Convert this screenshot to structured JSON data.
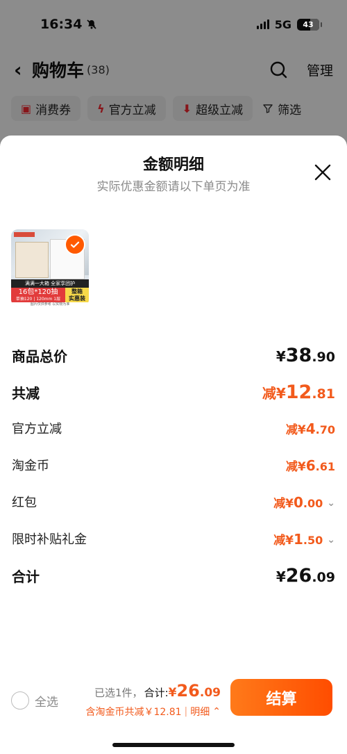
{
  "status_bar": {
    "time": "16:34",
    "network": "5G",
    "battery": "43"
  },
  "nav": {
    "title": "购物车",
    "count": "(38)",
    "manage": "管理"
  },
  "filters": [
    {
      "label": "消费券",
      "icon": "coupon-icon"
    },
    {
      "label": "官方立减",
      "icon": "lightning-icon"
    },
    {
      "label": "超级立减",
      "icon": "arrow-down-icon"
    },
    {
      "label": "筛选",
      "icon": "filter-icon"
    }
  ],
  "sheet": {
    "title": "金额明细",
    "subtitle": "实际优惠金额请以下单页为准",
    "product": {
      "band_text": "满满一大箱 全家享团护",
      "promo_main": "16包*120抽",
      "promo_sub": "单抽120 | 120mm 1层",
      "badge_line1": "整箱",
      "badge_line2": "实惠装",
      "footer_text": "图片仅供参考 以实物为准"
    }
  },
  "rows": {
    "total_price": {
      "label": "商品总价",
      "currency": "¥",
      "integer": "38",
      "decimal": ".90"
    },
    "total_reduce": {
      "label": "共减",
      "prefix": "减¥",
      "integer": "12",
      "decimal": ".81"
    },
    "official": {
      "label": "官方立减",
      "prefix": "减¥",
      "integer": "4",
      "decimal": ".70"
    },
    "taojinbi": {
      "label": "淘金币",
      "prefix": "减¥",
      "integer": "6",
      "decimal": ".61"
    },
    "hongbao": {
      "label": "红包",
      "prefix": "减¥",
      "integer": "0",
      "decimal": ".00"
    },
    "subsidy": {
      "label": "限时补贴礼金",
      "prefix": "减¥",
      "integer": "1",
      "decimal": ".50"
    },
    "sum": {
      "label": "合计",
      "currency": "¥",
      "integer": "26",
      "decimal": ".09"
    }
  },
  "bottom": {
    "select_all": "全选",
    "selected": "已选1件，",
    "total_label": "合计:",
    "total_currency": "¥",
    "total_integer": "26",
    "total_decimal": ".09",
    "saving_text": "含淘金币共减￥12.81",
    "separator": "|",
    "detail": "明细",
    "checkout": "结算"
  },
  "colors": {
    "accent": "#f25a1c",
    "checkout": "#ff5a00"
  }
}
